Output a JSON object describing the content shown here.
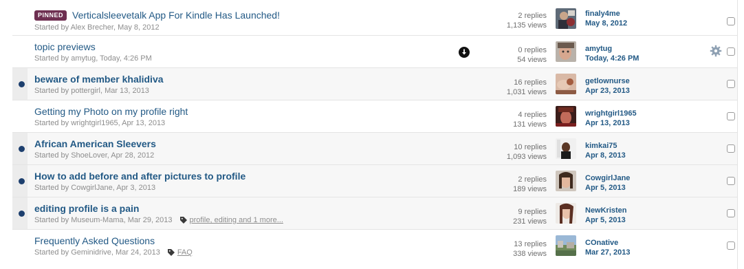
{
  "topics": [
    {
      "pinned_label": "PINNED",
      "title": "Verticalsleevetalk App For Kindle Has Launched!",
      "meta": "Started by Alex Brecher, May 8, 2012",
      "replies": "2 replies",
      "views": "1,135 views",
      "last_user": "finaly4me",
      "last_date": "May 8, 2012"
    },
    {
      "title": "topic previews",
      "meta": "Started by amytug, Today, 4:26 PM",
      "replies": "0 replies",
      "views": "54 views",
      "last_user": "amytug",
      "last_date": "Today, 4:26 PM"
    },
    {
      "title": "beware of member khalidiva",
      "meta": "Started by pottergirl, Mar 13, 2013",
      "replies": "16 replies",
      "views": "1,031 views",
      "last_user": "getlownurse",
      "last_date": "Apr 23, 2013"
    },
    {
      "title": "Getting my Photo on my profile right",
      "meta": "Started by wrightgirl1965, Apr 13, 2013",
      "replies": "4 replies",
      "views": "131 views",
      "last_user": "wrightgirl1965",
      "last_date": "Apr 13, 2013"
    },
    {
      "title": "African American Sleevers",
      "meta": "Started by ShoeLover, Apr 28, 2012",
      "replies": "10 replies",
      "views": "1,093 views",
      "last_user": "kimkai75",
      "last_date": "Apr 8, 2013"
    },
    {
      "title": "How to add before and after pictures to profile",
      "meta": "Started by CowgirlJane, Apr 3, 2013",
      "replies": "2 replies",
      "views": "189 views",
      "last_user": "CowgirlJane",
      "last_date": "Apr 5, 2013"
    },
    {
      "title": "editing profile is a pain",
      "meta": "Started by Museum-Mama, Mar 29, 2013",
      "tags": "profile, editing and 1 more...",
      "replies": "9 replies",
      "views": "231 views",
      "last_user": "NewKristen",
      "last_date": "Apr 5, 2013"
    },
    {
      "title": "Frequently Asked Questions",
      "meta": "Started by Geminidrive, Mar 24, 2013",
      "tags": "FAQ",
      "replies": "13 replies",
      "views": "338 views",
      "last_user": "COnative",
      "last_date": "Mar 27, 2013"
    }
  ],
  "icons": {
    "preview": "preview-arrow-icon",
    "gear": "gear-icon",
    "tag": "tag-icon",
    "unread": "unread-dot-icon"
  },
  "colors": {
    "link": "#225985",
    "badge": "#6e2f51",
    "unread_dot": "#1d3f6e",
    "meta_text": "#8d8d8d"
  }
}
